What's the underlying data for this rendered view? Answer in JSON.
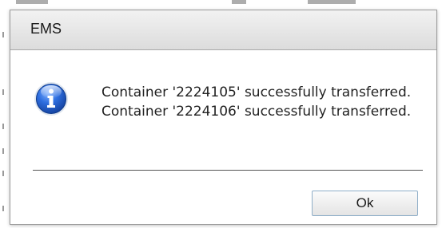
{
  "dialog": {
    "title": "EMS",
    "icon": "info-icon",
    "messages": [
      "Container '2224105' successfully transferred.",
      "Container '2224106' successfully transferred."
    ],
    "ok_label": "Ok"
  },
  "colors": {
    "icon_blue": "#2a63c9",
    "button_border": "#8faec8",
    "title_bg": "#e6e6e6"
  }
}
